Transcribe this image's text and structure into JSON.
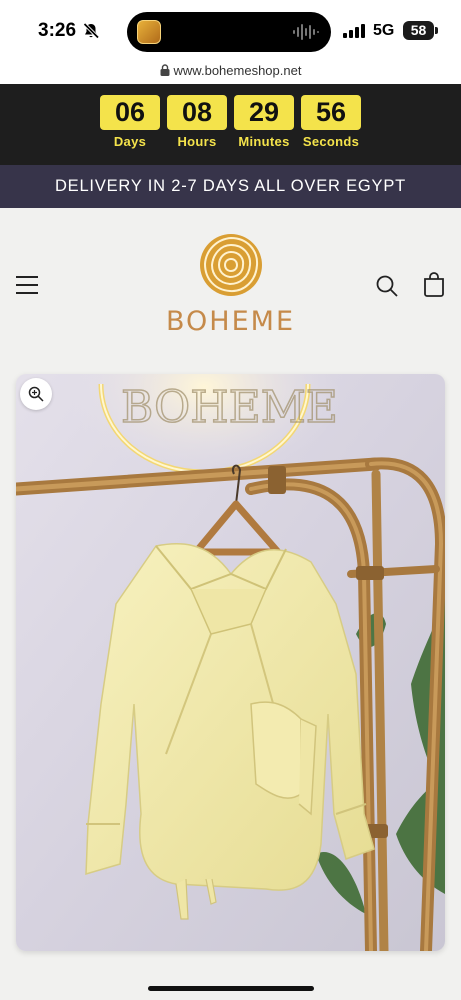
{
  "status_bar": {
    "time": "3:26",
    "network": "5G",
    "battery": "58"
  },
  "browser": {
    "url": "www.bohemeshop.net"
  },
  "countdown": [
    {
      "value": "06",
      "label": "Days"
    },
    {
      "value": "08",
      "label": "Hours"
    },
    {
      "value": "29",
      "label": "Minutes"
    },
    {
      "value": "56",
      "label": "Seconds"
    }
  ],
  "announcement": "DELIVERY IN 2-7 DAYS ALL OVER EGYPT",
  "header": {
    "logo_text": "BOHEME"
  },
  "colors": {
    "countdown_bg": "#1e1e1e",
    "countdown_accent": "#f4e34b",
    "announcement_bg": "#37344a",
    "brand": "#c58a4a"
  },
  "icons": [
    "bell-slash-icon",
    "signal-icon",
    "lock-icon",
    "menu-icon",
    "search-icon",
    "cart-icon",
    "zoom-icon"
  ]
}
